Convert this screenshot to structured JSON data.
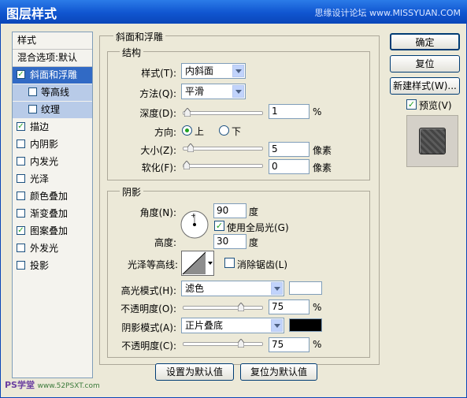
{
  "window": {
    "title": "图层样式",
    "watermark": "思缘设计论坛 www.MISSYUAN.COM"
  },
  "left_panel": {
    "items": [
      {
        "label": "样式",
        "type": "header"
      },
      {
        "label": "混合选项:默认",
        "type": "header"
      },
      {
        "label": "斜面和浮雕",
        "checked": true,
        "selected": true
      },
      {
        "label": "等高线",
        "checked": false,
        "sub": true
      },
      {
        "label": "纹理",
        "checked": false,
        "sub": true
      },
      {
        "label": "描边",
        "checked": true
      },
      {
        "label": "内阴影",
        "checked": false
      },
      {
        "label": "内发光",
        "checked": false
      },
      {
        "label": "光泽",
        "checked": false
      },
      {
        "label": "颜色叠加",
        "checked": false
      },
      {
        "label": "渐变叠加",
        "checked": false
      },
      {
        "label": "图案叠加",
        "checked": true
      },
      {
        "label": "外发光",
        "checked": false
      },
      {
        "label": "投影",
        "checked": false
      }
    ]
  },
  "bevel": {
    "title": "斜面和浮雕",
    "structure": {
      "title": "结构",
      "style_label": "样式(T):",
      "style_value": "内斜面",
      "technique_label": "方法(Q):",
      "technique_value": "平滑",
      "depth_label": "深度(D):",
      "depth_value": "1",
      "depth_unit": "%",
      "depth_level": 0.01,
      "direction_label": "方向:",
      "dir_up": "上",
      "dir_down": "下",
      "direction_selected": "上",
      "size_label": "大小(Z):",
      "size_value": "5",
      "size_unit": "像素",
      "size_level": 0.05,
      "soften_label": "软化(F):",
      "soften_value": "0",
      "soften_unit": "像素",
      "soften_level": 0.0
    },
    "shading": {
      "title": "阴影",
      "angle_label": "角度(N):",
      "angle_value": "90",
      "angle_unit": "度",
      "global_light_label": "使用全局光(G)",
      "global_light_checked": true,
      "altitude_label": "高度:",
      "altitude_value": "30",
      "altitude_unit": "度",
      "gloss_contour_label": "光泽等高线:",
      "antialias_label": "消除锯齿(L)",
      "antialias_checked": false,
      "highlight_mode_label": "高光模式(H):",
      "highlight_mode_value": "滤色",
      "highlight_color": "#ffffff",
      "highlight_opacity_label": "不透明度(O):",
      "highlight_opacity_value": "75",
      "highlight_opacity_unit": "%",
      "highlight_opacity_level": 0.75,
      "shadow_mode_label": "阴影模式(A):",
      "shadow_mode_value": "正片叠底",
      "shadow_color": "#000000",
      "shadow_opacity_label": "不透明度(C):",
      "shadow_opacity_value": "75",
      "shadow_opacity_unit": "%",
      "shadow_opacity_level": 0.75
    },
    "make_default": "设置为默认值",
    "reset_default": "复位为默认值"
  },
  "right_panel": {
    "ok": "确定",
    "reset": "复位",
    "new_style": "新建样式(W)...",
    "preview_label": "预览(V)",
    "preview_checked": true
  },
  "footer": {
    "brand": "PS学堂",
    "site": "www.52PSXT.com"
  }
}
